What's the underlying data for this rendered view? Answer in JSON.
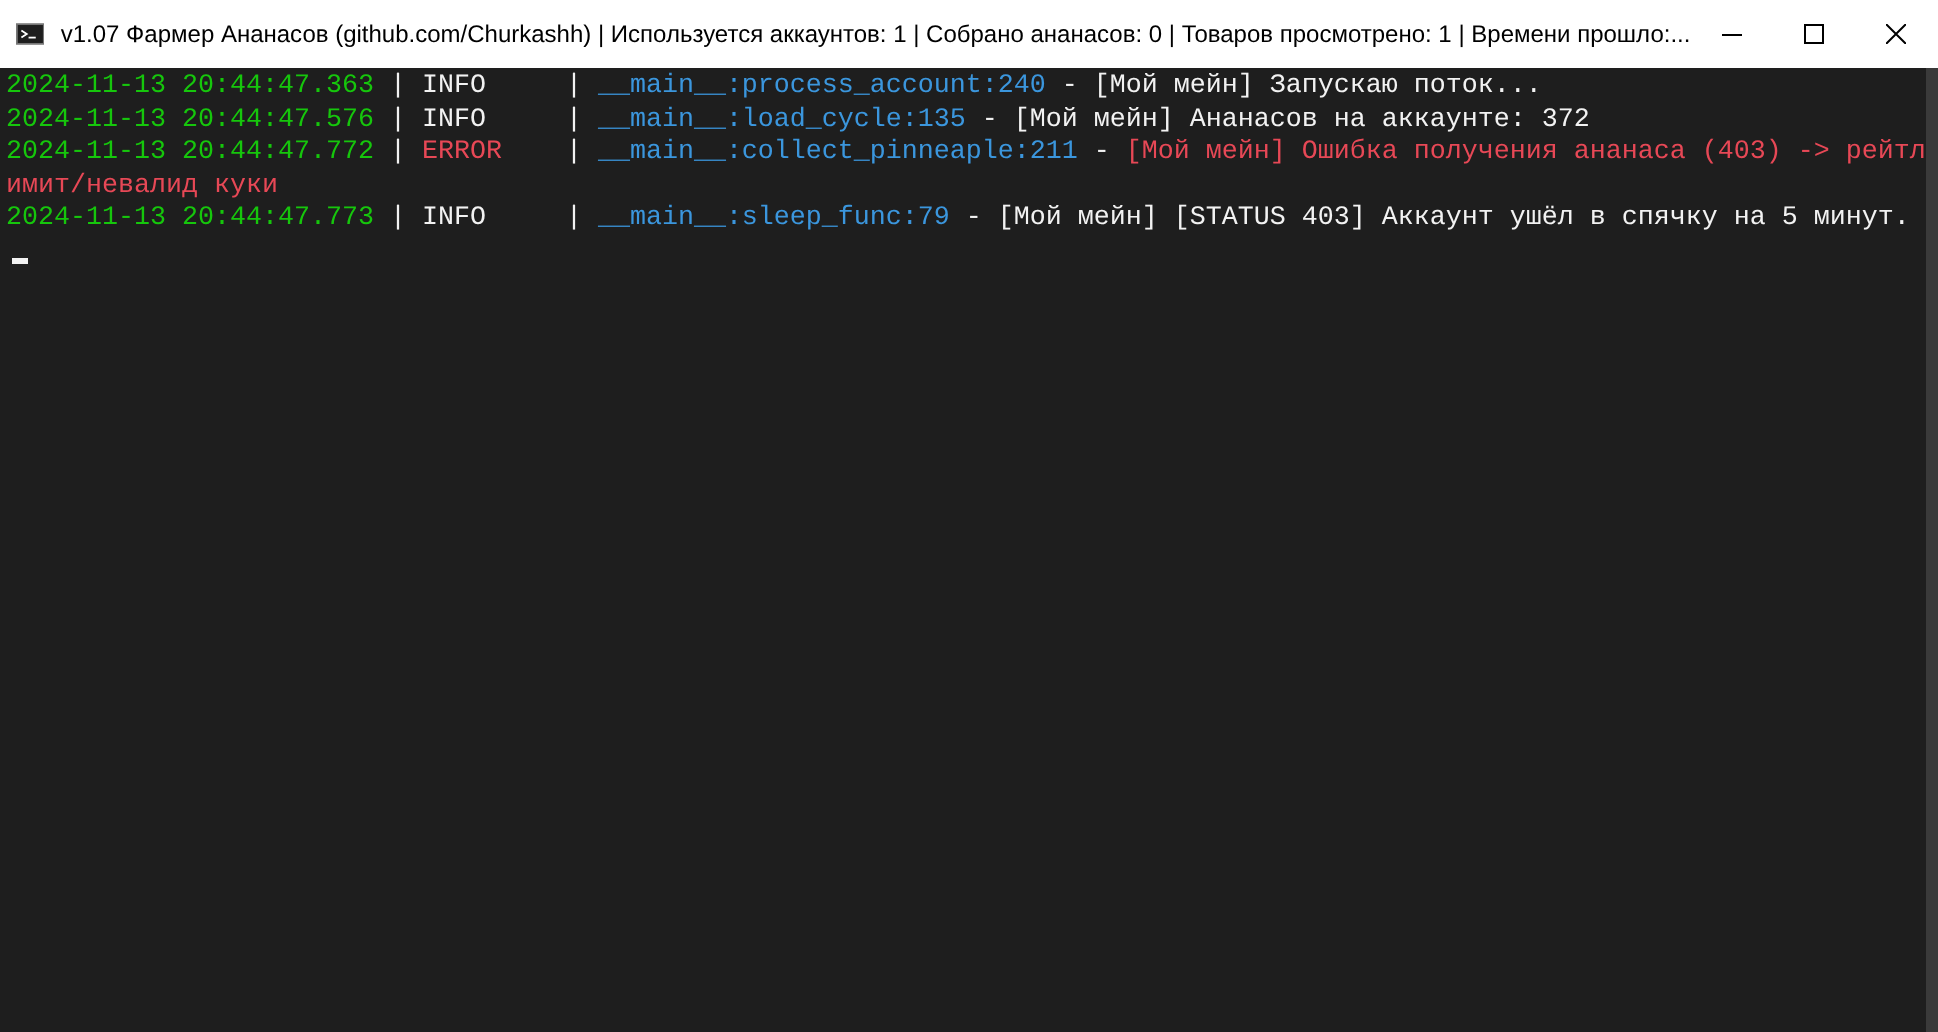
{
  "window": {
    "title": "v1.07 Фармер Ананасов (github.com/Churkashh) | Используется аккаунтов: 1 | Собрано ананасов: 0 | Товаров просмотрено: 1 | Времени прошло:..."
  },
  "log_lines": [
    {
      "time": "2024-11-13 20:44:47.363",
      "level": "INFO",
      "source_module": "__main__",
      "source_location": ":process_account:240",
      "message": "[Мой мейн] Запускаю поток...",
      "color": "#f2f2f2"
    },
    {
      "time": "2024-11-13 20:44:47.576",
      "level": "INFO",
      "source_module": "__main__",
      "source_location": ":load_cycle:135",
      "message": "[Мой мейн] Ананасов на аккаунте: 372",
      "color": "#f2f2f2"
    },
    {
      "time": "2024-11-13 20:44:47.772",
      "level": "ERROR",
      "source_module": "__main__",
      "source_location": ":collect_pinneaple:211",
      "message": "[Мой мейн] Ошибка получения ананаса (403) -> рейтл",
      "wrapped_continuation": "имит/невалид куки",
      "color": "#e74856"
    },
    {
      "time": "2024-11-13 20:44:47.773",
      "level": "INFO",
      "source_module": "__main__",
      "source_location": ":sleep_func:79",
      "message": "[Мой мейн] [STATUS 403] Аккаунт ушёл в спячку на 5 минут.",
      "color": "#f2f2f2"
    }
  ],
  "separator": "|",
  "dash": "-"
}
